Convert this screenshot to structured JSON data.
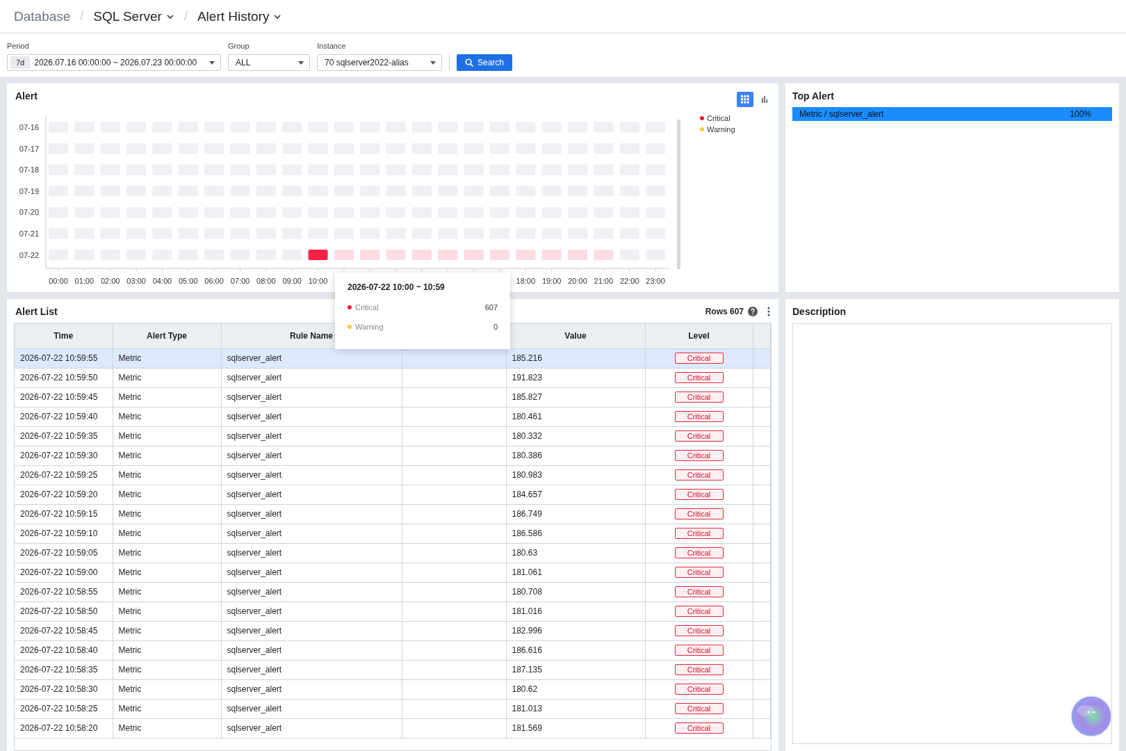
{
  "breadcrumb": [
    {
      "label": "Database",
      "dropdown": false
    },
    {
      "separator_before": "/",
      "label": "SQL Server",
      "dropdown": true
    },
    {
      "separator_before": "/",
      "label": "Alert History",
      "dropdown": true
    }
  ],
  "filters": {
    "period": {
      "label": "Period",
      "badge": "7d",
      "value": "2026.07.16 00:00:00 ~ 2026.07.23 00:00:00"
    },
    "group": {
      "label": "Group",
      "value": "ALL"
    },
    "instance": {
      "label": "Instance",
      "value": "70 sqlserver2022-alias"
    },
    "search_button": "Search"
  },
  "alert_chart": {
    "title": "Alert",
    "view_modes": [
      {
        "kind": "grid",
        "selected": true
      },
      {
        "kind": "bar",
        "selected": false
      }
    ],
    "legend": [
      {
        "label": "Critical",
        "color": "#e8193c"
      },
      {
        "label": "Warning",
        "color": "#fcc934"
      }
    ],
    "x_labels_left": [
      "00:00",
      "01:00",
      "02:00",
      "03:00",
      "04:00",
      "05:00",
      "06:00",
      "07:00",
      "08:00",
      "09:00",
      "10:00"
    ],
    "x_labels_right": [
      "18:00",
      "19:00",
      "20:00",
      "21:00",
      "22:00",
      "23:00"
    ],
    "rows": [
      {
        "label": "07-16",
        "cells": [
          {
            "kind": "empty",
            "selected": false
          },
          {
            "kind": "empty",
            "selected": false
          },
          {
            "kind": "empty",
            "selected": false
          },
          {
            "kind": "empty",
            "selected": false
          },
          {
            "kind": "empty",
            "selected": false
          },
          {
            "kind": "empty",
            "selected": false
          },
          {
            "kind": "empty",
            "selected": false
          },
          {
            "kind": "empty",
            "selected": false
          },
          {
            "kind": "empty",
            "selected": false
          },
          {
            "kind": "empty",
            "selected": false
          },
          {
            "kind": "empty",
            "selected": false
          },
          {
            "kind": "empty",
            "selected": false
          },
          {
            "kind": "empty",
            "selected": false
          },
          {
            "kind": "empty",
            "selected": false
          },
          {
            "kind": "empty",
            "selected": false
          },
          {
            "kind": "empty",
            "selected": false
          },
          {
            "kind": "empty",
            "selected": false
          },
          {
            "kind": "empty",
            "selected": false
          },
          {
            "kind": "empty",
            "selected": false
          },
          {
            "kind": "empty",
            "selected": false
          },
          {
            "kind": "empty",
            "selected": false
          },
          {
            "kind": "empty",
            "selected": false
          },
          {
            "kind": "empty",
            "selected": false
          },
          {
            "kind": "empty",
            "selected": false
          }
        ]
      },
      {
        "label": "07-17",
        "cells": [
          {
            "kind": "empty",
            "selected": false
          },
          {
            "kind": "empty",
            "selected": false
          },
          {
            "kind": "empty",
            "selected": false
          },
          {
            "kind": "empty",
            "selected": false
          },
          {
            "kind": "empty",
            "selected": false
          },
          {
            "kind": "empty",
            "selected": false
          },
          {
            "kind": "empty",
            "selected": false
          },
          {
            "kind": "empty",
            "selected": false
          },
          {
            "kind": "empty",
            "selected": false
          },
          {
            "kind": "empty",
            "selected": false
          },
          {
            "kind": "empty",
            "selected": false
          },
          {
            "kind": "empty",
            "selected": false
          },
          {
            "kind": "empty",
            "selected": false
          },
          {
            "kind": "empty",
            "selected": false
          },
          {
            "kind": "empty",
            "selected": false
          },
          {
            "kind": "empty",
            "selected": false
          },
          {
            "kind": "empty",
            "selected": false
          },
          {
            "kind": "empty",
            "selected": false
          },
          {
            "kind": "empty",
            "selected": false
          },
          {
            "kind": "empty",
            "selected": false
          },
          {
            "kind": "empty",
            "selected": false
          },
          {
            "kind": "empty",
            "selected": false
          },
          {
            "kind": "empty",
            "selected": false
          },
          {
            "kind": "empty",
            "selected": false
          }
        ]
      },
      {
        "label": "07-18",
        "cells": [
          {
            "kind": "empty",
            "selected": false
          },
          {
            "kind": "empty",
            "selected": false
          },
          {
            "kind": "empty",
            "selected": false
          },
          {
            "kind": "empty",
            "selected": false
          },
          {
            "kind": "empty",
            "selected": false
          },
          {
            "kind": "empty",
            "selected": false
          },
          {
            "kind": "empty",
            "selected": false
          },
          {
            "kind": "empty",
            "selected": false
          },
          {
            "kind": "empty",
            "selected": false
          },
          {
            "kind": "empty",
            "selected": false
          },
          {
            "kind": "empty",
            "selected": false
          },
          {
            "kind": "empty",
            "selected": false
          },
          {
            "kind": "empty",
            "selected": false
          },
          {
            "kind": "empty",
            "selected": false
          },
          {
            "kind": "empty",
            "selected": false
          },
          {
            "kind": "empty",
            "selected": false
          },
          {
            "kind": "empty",
            "selected": false
          },
          {
            "kind": "empty",
            "selected": false
          },
          {
            "kind": "empty",
            "selected": false
          },
          {
            "kind": "empty",
            "selected": false
          },
          {
            "kind": "empty",
            "selected": false
          },
          {
            "kind": "empty",
            "selected": false
          },
          {
            "kind": "empty",
            "selected": false
          },
          {
            "kind": "empty",
            "selected": false
          }
        ]
      },
      {
        "label": "07-19",
        "cells": [
          {
            "kind": "empty",
            "selected": false
          },
          {
            "kind": "empty",
            "selected": false
          },
          {
            "kind": "empty",
            "selected": false
          },
          {
            "kind": "empty",
            "selected": false
          },
          {
            "kind": "empty",
            "selected": false
          },
          {
            "kind": "empty",
            "selected": false
          },
          {
            "kind": "empty",
            "selected": false
          },
          {
            "kind": "empty",
            "selected": false
          },
          {
            "kind": "empty",
            "selected": false
          },
          {
            "kind": "empty",
            "selected": false
          },
          {
            "kind": "empty",
            "selected": false
          },
          {
            "kind": "empty",
            "selected": false
          },
          {
            "kind": "empty",
            "selected": false
          },
          {
            "kind": "empty",
            "selected": false
          },
          {
            "kind": "empty",
            "selected": false
          },
          {
            "kind": "empty",
            "selected": false
          },
          {
            "kind": "empty",
            "selected": false
          },
          {
            "kind": "empty",
            "selected": false
          },
          {
            "kind": "empty",
            "selected": false
          },
          {
            "kind": "empty",
            "selected": false
          },
          {
            "kind": "empty",
            "selected": false
          },
          {
            "kind": "empty",
            "selected": false
          },
          {
            "kind": "empty",
            "selected": false
          },
          {
            "kind": "empty",
            "selected": false
          }
        ]
      },
      {
        "label": "07-20",
        "cells": [
          {
            "kind": "empty",
            "selected": false
          },
          {
            "kind": "empty",
            "selected": false
          },
          {
            "kind": "empty",
            "selected": false
          },
          {
            "kind": "empty",
            "selected": false
          },
          {
            "kind": "empty",
            "selected": false
          },
          {
            "kind": "empty",
            "selected": false
          },
          {
            "kind": "empty",
            "selected": false
          },
          {
            "kind": "empty",
            "selected": false
          },
          {
            "kind": "empty",
            "selected": false
          },
          {
            "kind": "empty",
            "selected": false
          },
          {
            "kind": "empty",
            "selected": false
          },
          {
            "kind": "empty",
            "selected": false
          },
          {
            "kind": "empty",
            "selected": false
          },
          {
            "kind": "empty",
            "selected": false
          },
          {
            "kind": "empty",
            "selected": false
          },
          {
            "kind": "empty",
            "selected": false
          },
          {
            "kind": "empty",
            "selected": false
          },
          {
            "kind": "empty",
            "selected": false
          },
          {
            "kind": "empty",
            "selected": false
          },
          {
            "kind": "empty",
            "selected": false
          },
          {
            "kind": "empty",
            "selected": false
          },
          {
            "kind": "empty",
            "selected": false
          },
          {
            "kind": "empty",
            "selected": false
          },
          {
            "kind": "empty",
            "selected": false
          }
        ]
      },
      {
        "label": "07-21",
        "cells": [
          {
            "kind": "empty",
            "selected": false
          },
          {
            "kind": "empty",
            "selected": false
          },
          {
            "kind": "empty",
            "selected": false
          },
          {
            "kind": "empty",
            "selected": false
          },
          {
            "kind": "empty",
            "selected": false
          },
          {
            "kind": "empty",
            "selected": false
          },
          {
            "kind": "empty",
            "selected": false
          },
          {
            "kind": "empty",
            "selected": false
          },
          {
            "kind": "empty",
            "selected": false
          },
          {
            "kind": "empty",
            "selected": false
          },
          {
            "kind": "empty",
            "selected": false
          },
          {
            "kind": "empty",
            "selected": false
          },
          {
            "kind": "empty",
            "selected": false
          },
          {
            "kind": "empty",
            "selected": false
          },
          {
            "kind": "empty",
            "selected": false
          },
          {
            "kind": "empty",
            "selected": false
          },
          {
            "kind": "empty",
            "selected": false
          },
          {
            "kind": "empty",
            "selected": false
          },
          {
            "kind": "empty",
            "selected": false
          },
          {
            "kind": "empty",
            "selected": false
          },
          {
            "kind": "empty",
            "selected": false
          },
          {
            "kind": "empty",
            "selected": false
          },
          {
            "kind": "empty",
            "selected": false
          },
          {
            "kind": "empty",
            "selected": false
          }
        ]
      },
      {
        "label": "07-22",
        "cells": [
          {
            "kind": "empty",
            "selected": false
          },
          {
            "kind": "empty",
            "selected": false
          },
          {
            "kind": "empty",
            "selected": false
          },
          {
            "kind": "empty",
            "selected": false
          },
          {
            "kind": "empty",
            "selected": false
          },
          {
            "kind": "empty",
            "selected": false
          },
          {
            "kind": "empty",
            "selected": false
          },
          {
            "kind": "empty",
            "selected": false
          },
          {
            "kind": "empty",
            "selected": false
          },
          {
            "kind": "empty",
            "selected": false
          },
          {
            "kind": "alert",
            "selected": true
          },
          {
            "kind": "alert",
            "selected": false
          },
          {
            "kind": "alert",
            "selected": false
          },
          {
            "kind": "alert",
            "selected": false
          },
          {
            "kind": "alert",
            "selected": false
          },
          {
            "kind": "alert",
            "selected": false
          },
          {
            "kind": "alert",
            "selected": false
          },
          {
            "kind": "alert",
            "selected": false
          },
          {
            "kind": "alert",
            "selected": false
          },
          {
            "kind": "alert",
            "selected": false
          },
          {
            "kind": "alert",
            "selected": false
          },
          {
            "kind": "alert",
            "selected": false
          },
          {
            "kind": "empty",
            "selected": false
          },
          {
            "kind": "empty",
            "selected": false
          }
        ]
      }
    ],
    "tooltip": {
      "title": "2026-07-22 10:00 ~ 10:59",
      "items": [
        {
          "label": "Critical",
          "value": "607",
          "color": "#e8193c"
        },
        {
          "label": "Warning",
          "value": "0",
          "color": "#fcc934"
        }
      ]
    }
  },
  "top_alert": {
    "title": "Top Alert",
    "items": [
      {
        "label": "Metric / sqlserver_alert",
        "percent": "100%",
        "level": 1
      }
    ]
  },
  "alert_list": {
    "title": "Alert List",
    "rows_label": "Rows 607",
    "columns_left": [
      "Time",
      "Alert Type",
      "Rule Name"
    ],
    "columns_right": [
      "Value",
      "Level"
    ],
    "rows": [
      {
        "time": "2026-07-22 10:59:55",
        "alert_type": "Metric",
        "rule_name": "sqlserver_alert",
        "value": "185.216",
        "badge": {
          "text": "Critical",
          "kind": "critical"
        },
        "selected": true
      },
      {
        "time": "2026-07-22 10:59:50",
        "alert_type": "Metric",
        "rule_name": "sqlserver_alert",
        "value": "191.823",
        "badge": {
          "text": "Critical",
          "kind": "critical"
        },
        "selected": false
      },
      {
        "time": "2026-07-22 10:59:45",
        "alert_type": "Metric",
        "rule_name": "sqlserver_alert",
        "value": "185.827",
        "badge": {
          "text": "Critical",
          "kind": "critical"
        },
        "selected": false
      },
      {
        "time": "2026-07-22 10:59:40",
        "alert_type": "Metric",
        "rule_name": "sqlserver_alert",
        "value": "180.461",
        "badge": {
          "text": "Critical",
          "kind": "critical"
        },
        "selected": false
      },
      {
        "time": "2026-07-22 10:59:35",
        "alert_type": "Metric",
        "rule_name": "sqlserver_alert",
        "value": "180.332",
        "badge": {
          "text": "Critical",
          "kind": "critical"
        },
        "selected": false
      },
      {
        "time": "2026-07-22 10:59:30",
        "alert_type": "Metric",
        "rule_name": "sqlserver_alert",
        "value": "180.386",
        "badge": {
          "text": "Critical",
          "kind": "critical"
        },
        "selected": false
      },
      {
        "time": "2026-07-22 10:59:25",
        "alert_type": "Metric",
        "rule_name": "sqlserver_alert",
        "value": "180.983",
        "badge": {
          "text": "Critical",
          "kind": "critical"
        },
        "selected": false
      },
      {
        "time": "2026-07-22 10:59:20",
        "alert_type": "Metric",
        "rule_name": "sqlserver_alert",
        "value": "184.657",
        "badge": {
          "text": "Critical",
          "kind": "critical"
        },
        "selected": false
      },
      {
        "time": "2026-07-22 10:59:15",
        "alert_type": "Metric",
        "rule_name": "sqlserver_alert",
        "value": "186.749",
        "badge": {
          "text": "Critical",
          "kind": "critical"
        },
        "selected": false
      },
      {
        "time": "2026-07-22 10:59:10",
        "alert_type": "Metric",
        "rule_name": "sqlserver_alert",
        "value": "186.586",
        "badge": {
          "text": "Critical",
          "kind": "critical"
        },
        "selected": false
      },
      {
        "time": "2026-07-22 10:59:05",
        "alert_type": "Metric",
        "rule_name": "sqlserver_alert",
        "value": "180.63",
        "badge": {
          "text": "Critical",
          "kind": "critical"
        },
        "selected": false
      },
      {
        "time": "2026-07-22 10:59:00",
        "alert_type": "Metric",
        "rule_name": "sqlserver_alert",
        "value": "181.061",
        "badge": {
          "text": "Critical",
          "kind": "critical"
        },
        "selected": false
      },
      {
        "time": "2026-07-22 10:58:55",
        "alert_type": "Metric",
        "rule_name": "sqlserver_alert",
        "value": "180.708",
        "badge": {
          "text": "Critical",
          "kind": "critical"
        },
        "selected": false
      },
      {
        "time": "2026-07-22 10:58:50",
        "alert_type": "Metric",
        "rule_name": "sqlserver_alert",
        "value": "181.016",
        "badge": {
          "text": "Critical",
          "kind": "critical"
        },
        "selected": false
      },
      {
        "time": "2026-07-22 10:58:45",
        "alert_type": "Metric",
        "rule_name": "sqlserver_alert",
        "value": "182.996",
        "badge": {
          "text": "Critical",
          "kind": "critical"
        },
        "selected": false
      },
      {
        "time": "2026-07-22 10:58:40",
        "alert_type": "Metric",
        "rule_name": "sqlserver_alert",
        "value": "186.616",
        "badge": {
          "text": "Critical",
          "kind": "critical"
        },
        "selected": false
      },
      {
        "time": "2026-07-22 10:58:35",
        "alert_type": "Metric",
        "rule_name": "sqlserver_alert",
        "value": "187.135",
        "badge": {
          "text": "Critical",
          "kind": "critical"
        },
        "selected": false
      },
      {
        "time": "2026-07-22 10:58:30",
        "alert_type": "Metric",
        "rule_name": "sqlserver_alert",
        "value": "180.62",
        "badge": {
          "text": "Critical",
          "kind": "critical"
        },
        "selected": false
      },
      {
        "time": "2026-07-22 10:58:25",
        "alert_type": "Metric",
        "rule_name": "sqlserver_alert",
        "value": "181.013",
        "badge": {
          "text": "Critical",
          "kind": "critical"
        },
        "selected": false
      },
      {
        "time": "2026-07-22 10:58:20",
        "alert_type": "Metric",
        "rule_name": "sqlserver_alert",
        "value": "181.569",
        "badge": {
          "text": "Critical",
          "kind": "critical"
        },
        "selected": false
      }
    ]
  },
  "description": {
    "title": "Description"
  }
}
